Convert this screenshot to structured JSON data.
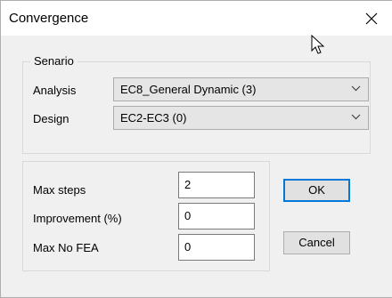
{
  "window": {
    "title": "Convergence",
    "close_glyph": "✕"
  },
  "scenario": {
    "legend": "Senario",
    "analysis_label": "Analysis",
    "analysis_value": "EC8_General Dynamic (3)",
    "design_label": "Design",
    "design_value": "EC2-EC3  (0)"
  },
  "settings": {
    "max_steps_label": "Max steps",
    "max_steps_value": "2",
    "improvement_label": "Improvement (%)",
    "improvement_value": "0",
    "max_fea_label": "Max No FEA",
    "max_fea_value": "0"
  },
  "buttons": {
    "ok_label": "OK",
    "cancel_label": "Cancel"
  },
  "icons": {
    "close": "close-icon",
    "dropdown": "chevron-down-icon",
    "cursor": "mouse-pointer-icon"
  },
  "colors": {
    "accent": "#0078d7",
    "dialog_bg": "#f0f0f0",
    "titlebar_bg": "#ffffff"
  }
}
